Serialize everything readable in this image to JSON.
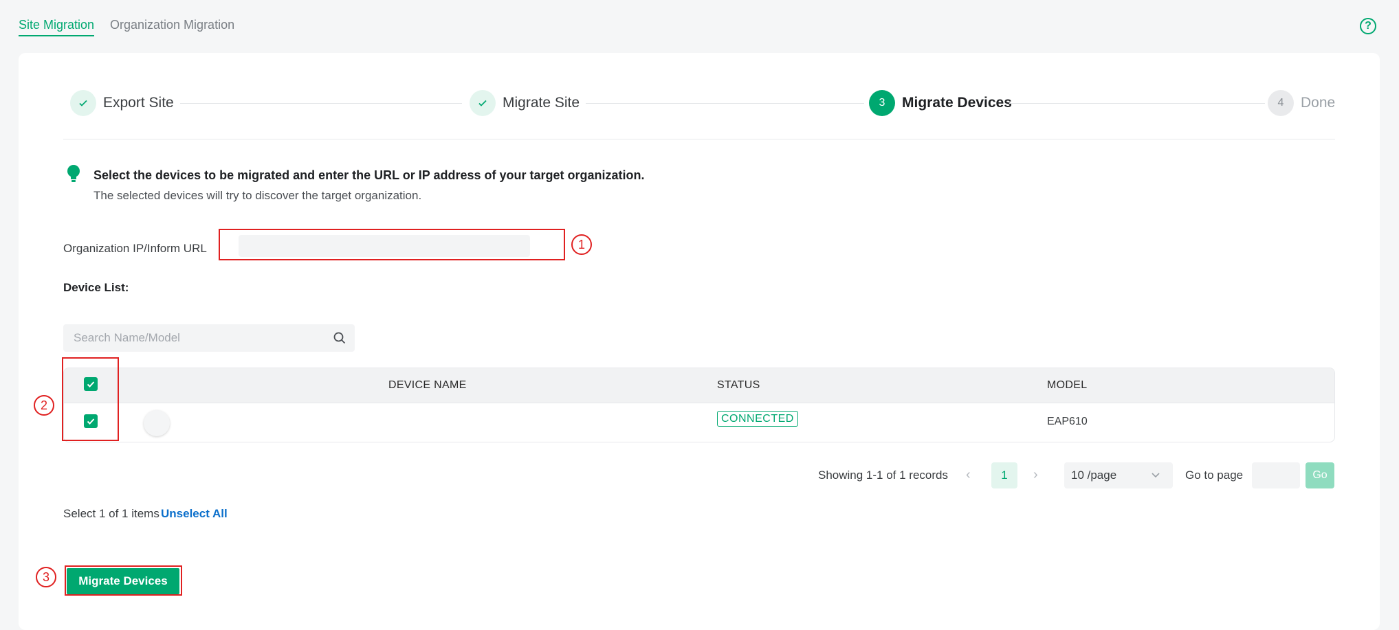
{
  "tabs": [
    {
      "label": "Site Migration"
    },
    {
      "label": "Organization Migration"
    }
  ],
  "help_icon": "question-circle-icon",
  "steps": [
    {
      "index": "1",
      "label": "Export Site",
      "state": "done"
    },
    {
      "index": "2",
      "label": "Migrate Site",
      "state": "done"
    },
    {
      "index": "3",
      "label": "Migrate Devices",
      "state": "active"
    },
    {
      "index": "4",
      "label": "Done",
      "state": "todo"
    }
  ],
  "tip": {
    "title": "Select the devices to be migrated and enter the URL or IP address of your target organization.",
    "subtitle": "The selected devices will try to discover the target organization."
  },
  "org_url": {
    "label": "Organization IP/Inform URL",
    "value": ""
  },
  "device_list": {
    "label": "Device List:",
    "search_placeholder": "Search Name/Model",
    "columns": [
      "DEVICE NAME",
      "STATUS",
      "MODEL"
    ],
    "rows": [
      {
        "name": "",
        "status": "CONNECTED",
        "model": "EAP610",
        "checked": true
      }
    ],
    "select_all_checked": true
  },
  "pagination": {
    "showing": "Showing 1-1 of 1 records",
    "page": "1",
    "page_size": "10 /page",
    "goto_label": "Go to page",
    "go_label": "Go"
  },
  "selection": {
    "summary": "Select 1 of 1 items",
    "unselect_label": "Unselect All"
  },
  "migrate_button": "Migrate Devices",
  "callouts": [
    "1",
    "2",
    "3"
  ],
  "colors": {
    "accent": "#00a870",
    "annotation_red": "#e02020",
    "link": "#0b6fcb"
  }
}
